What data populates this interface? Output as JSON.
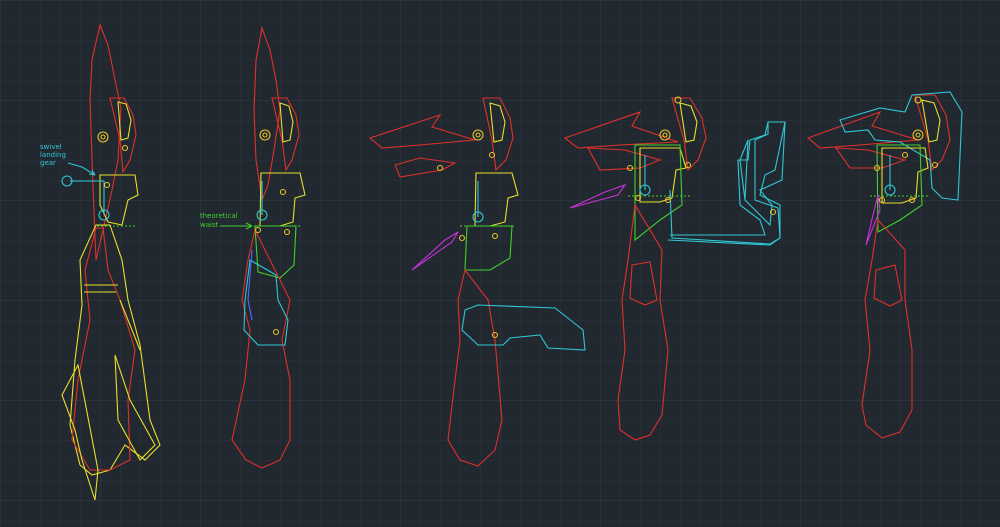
{
  "drawing": {
    "background": "#212830",
    "grid_minor": "#2a323c",
    "grid_major": "#333c47",
    "colors": {
      "red": "#e0302a",
      "yellow": "#e6e029",
      "green": "#3fd22a",
      "cyan": "#30c8d4",
      "magenta": "#c833d8",
      "blue": "#4a6cff",
      "hinge": "#e8c52a"
    }
  },
  "annotations": {
    "swivel_gear": [
      "swivel",
      "landing",
      "gear"
    ],
    "theoretical_waist": [
      "theoretical",
      "waist"
    ]
  }
}
